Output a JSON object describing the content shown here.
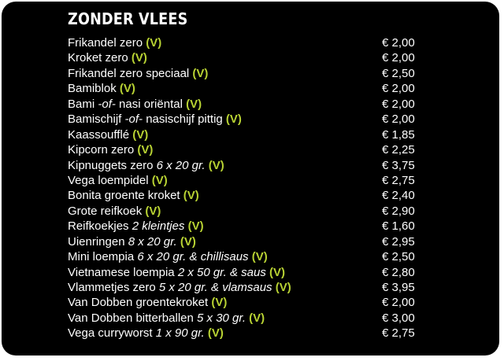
{
  "heading": "ZONDER VLEES",
  "veg_color": "#b8d233",
  "items": [
    {
      "name": "Frikandel zero",
      "detail": "",
      "suffix": "",
      "tag": "(V)",
      "price": "€ 2,00"
    },
    {
      "name": "Kroket zero",
      "detail": "",
      "suffix": "",
      "tag": "(V)",
      "price": "€ 2,00"
    },
    {
      "name": "Frikandel zero speciaal",
      "detail": "",
      "suffix": "",
      "tag": "(V)",
      "price": "€ 2,50"
    },
    {
      "name": "Bamiblok",
      "detail": "",
      "suffix": "",
      "tag": "(V)",
      "price": "€ 2,00"
    },
    {
      "name": "Bami",
      "detail": "-of-",
      "suffix": "nasi oriëntal",
      "tag": "(V)",
      "price": "€ 2,00"
    },
    {
      "name": "Bamischijf",
      "detail": "-of-",
      "suffix": "nasischijf pittig",
      "tag": "(V)",
      "price": "€ 2,00"
    },
    {
      "name": "Kaassoufflé",
      "detail": "",
      "suffix": "",
      "tag": "(V)",
      "price": "€ 1,85"
    },
    {
      "name": "Kipcorn zero",
      "detail": "",
      "suffix": "",
      "tag": "(V)",
      "price": "€ 2,25"
    },
    {
      "name": "Kipnuggets zero",
      "detail": "6 x 20 gr.",
      "suffix": "",
      "tag": "(V)",
      "price": "€ 3,75"
    },
    {
      "name": "Vega loempidel",
      "detail": "",
      "suffix": "",
      "tag": "(V)",
      "price": "€ 2,75"
    },
    {
      "name": "Bonita groente kroket",
      "detail": "",
      "suffix": "",
      "tag": "(V)",
      "price": "€ 2,40"
    },
    {
      "name": "Grote reifkoek",
      "detail": "",
      "suffix": "",
      "tag": "(V)",
      "price": "€ 2,90"
    },
    {
      "name": "Reifkoekjes",
      "detail": "2 kleintjes",
      "suffix": "",
      "tag": "(V)",
      "price": "€ 1,60"
    },
    {
      "name": "Uienringen",
      "detail": "8 x 20 gr.",
      "suffix": "",
      "tag": "(V)",
      "price": "€ 2,95"
    },
    {
      "name": "Mini loempia",
      "detail": "6 x 20 gr. & chillisaus",
      "suffix": "",
      "tag": "(V)",
      "price": "€ 2,50"
    },
    {
      "name": "Vietnamese loempia",
      "detail": "2 x 50 gr. & saus",
      "suffix": "",
      "tag": "(V)",
      "price": "€ 2,80"
    },
    {
      "name": "Vlammetjes zero",
      "detail": "5 x 20 gr. & vlamsaus",
      "suffix": "",
      "tag": "(V)",
      "price": "€ 3,95"
    },
    {
      "name": "Van Dobben groentekroket",
      "detail": "",
      "suffix": "",
      "tag": "(V)",
      "price": "€ 2,00"
    },
    {
      "name": "Van Dobben bitterballen",
      "detail": "5 x 30 gr.",
      "suffix": "",
      "tag": "(V)",
      "price": "€ 3,00"
    },
    {
      "name": "Vega curryworst",
      "detail": "1 x 90 gr.",
      "suffix": "",
      "tag": "(V)",
      "price": "€ 2,75"
    }
  ]
}
